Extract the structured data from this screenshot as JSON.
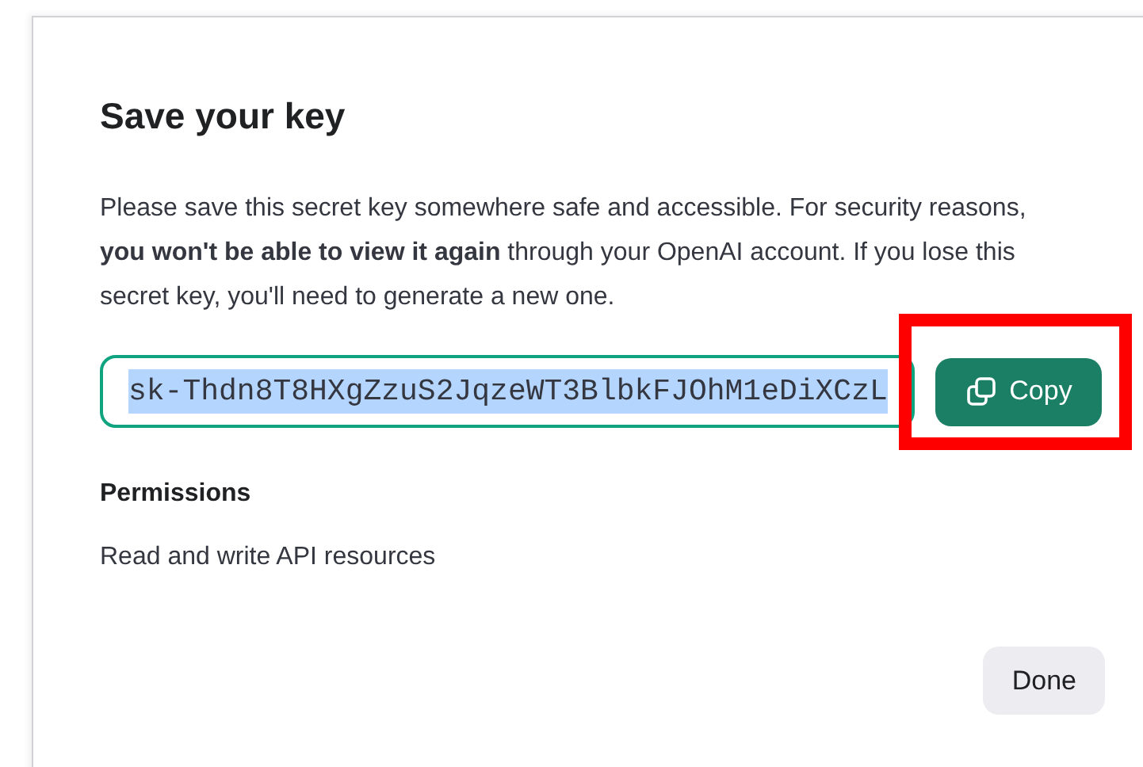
{
  "dialog": {
    "title": "Save your key",
    "message": "Please save this secret key somewhere safe and accessible. For security reasons, **you won't be able to view it again** through your OpenAI account. If you lose this secret key, you'll need to generate a new one.",
    "key_field": {
      "value": "sk-Thdn8T8HXgZzuS2JqzeWT3BlbkFJOhM1eDiXCzL",
      "selected": true
    },
    "copy_button": {
      "label": "Copy",
      "highlighted": true
    },
    "permissions": {
      "heading": "Permissions",
      "value": "Read and write API resources"
    },
    "buttons": [
      {
        "label": "Done"
      }
    ]
  }
}
